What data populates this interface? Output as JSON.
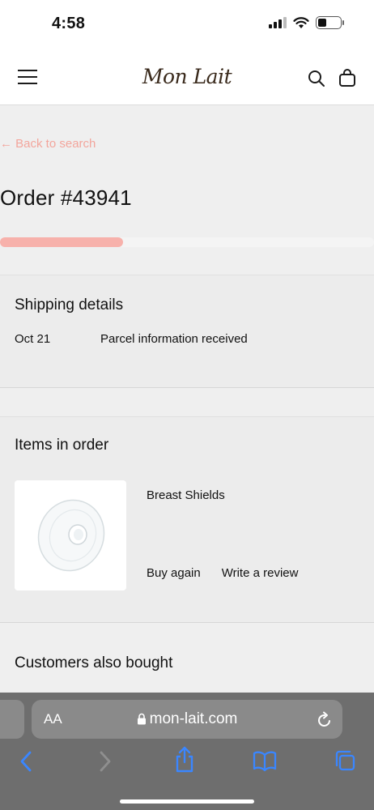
{
  "status_bar": {
    "time": "4:58"
  },
  "header": {
    "logo": "Mon Lait"
  },
  "order": {
    "back_label": "← Back to search",
    "title": "Order #43941",
    "progress_fraction": 0.33
  },
  "shipping": {
    "title": "Shipping details",
    "events": [
      {
        "date": "Oct 21",
        "status": "Parcel information received"
      }
    ]
  },
  "items": {
    "title": "Items in order",
    "products": [
      {
        "name": "Breast Shields",
        "buy_again": "Buy again",
        "review": "Write a review"
      }
    ]
  },
  "also_bought": {
    "title": "Customers also bought"
  },
  "browser": {
    "text_size_label": "AA",
    "url": "mon-lait.com"
  },
  "colors": {
    "accent": "#f7b1ab",
    "link": "#f3a59c",
    "brand": "#3a2a1c",
    "ios_blue": "#3a86ff"
  }
}
